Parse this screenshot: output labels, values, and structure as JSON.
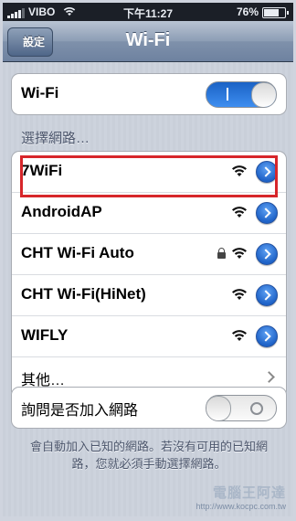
{
  "status_bar": {
    "carrier": "VIBO",
    "time": "下午11:27",
    "battery_percent": "76%"
  },
  "nav": {
    "back_label": "設定",
    "title": "Wi-Fi"
  },
  "wifi_toggle": {
    "label": "Wi-Fi",
    "state": "on"
  },
  "networks": {
    "header": "選擇網路…",
    "items": [
      {
        "name": "7WiFi",
        "locked": false,
        "highlighted": true
      },
      {
        "name": "AndroidAP",
        "locked": false
      },
      {
        "name": "CHT Wi-Fi Auto",
        "locked": true
      },
      {
        "name": "CHT Wi-Fi(HiNet)",
        "locked": false
      },
      {
        "name": "WIFLY",
        "locked": false
      }
    ],
    "other_label": "其他…"
  },
  "ask_join": {
    "label": "詢問是否加入網路",
    "state": "off"
  },
  "footer_note": "會自動加入已知的網路。若沒有可用的已知網路，您就必須手動選擇網路。",
  "watermark": {
    "title": "電腦王阿達",
    "url": "http://www.kocpc.com.tw"
  },
  "colors": {
    "highlight": "#d7262a",
    "toggle_on": "#2f7de0",
    "detail_button": "#2a6fd6"
  }
}
